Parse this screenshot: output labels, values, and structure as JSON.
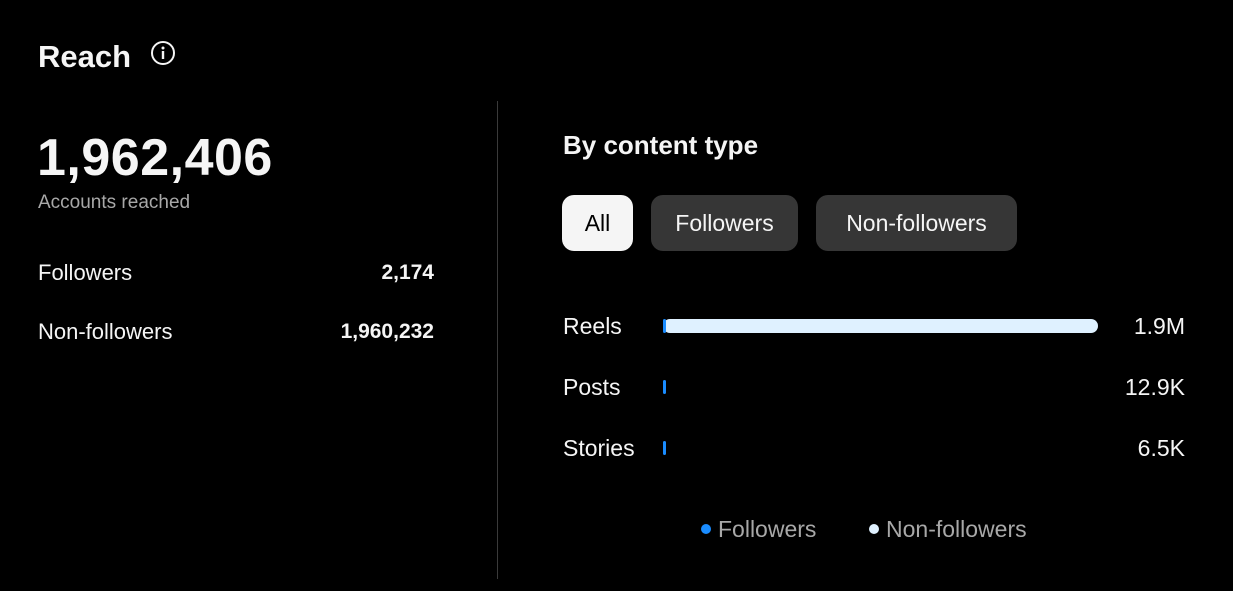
{
  "header": {
    "title": "Reach",
    "info_icon": "info-circle-icon"
  },
  "summary": {
    "total": "1,962,406",
    "total_label": "Accounts reached",
    "rows": [
      {
        "label": "Followers",
        "value": "2,174"
      },
      {
        "label": "Non-followers",
        "value": "1,960,232"
      }
    ]
  },
  "content_type": {
    "title": "By content type",
    "filters": [
      {
        "label": "All",
        "selected": true
      },
      {
        "label": "Followers",
        "selected": false
      },
      {
        "label": "Non-followers",
        "selected": false
      }
    ],
    "bars": [
      {
        "label": "Reels",
        "value": "1.9M",
        "followers_fraction": 0.003,
        "total_fraction": 1.0
      },
      {
        "label": "Posts",
        "value": "12.9K",
        "followers_fraction": 0.0,
        "total_fraction": 0.0068
      },
      {
        "label": "Stories",
        "value": "6.5K",
        "followers_fraction": 0.0,
        "total_fraction": 0.0034
      }
    ],
    "legend": [
      {
        "label": "Followers",
        "color": "#1a8cff"
      },
      {
        "label": "Non-followers",
        "color": "#dff1ff"
      }
    ]
  },
  "colors": {
    "background": "#000000",
    "followers": "#1a8cff",
    "non_followers": "#dff1ff",
    "pill_active": "#f5f5f5",
    "pill_inactive": "#363636"
  }
}
